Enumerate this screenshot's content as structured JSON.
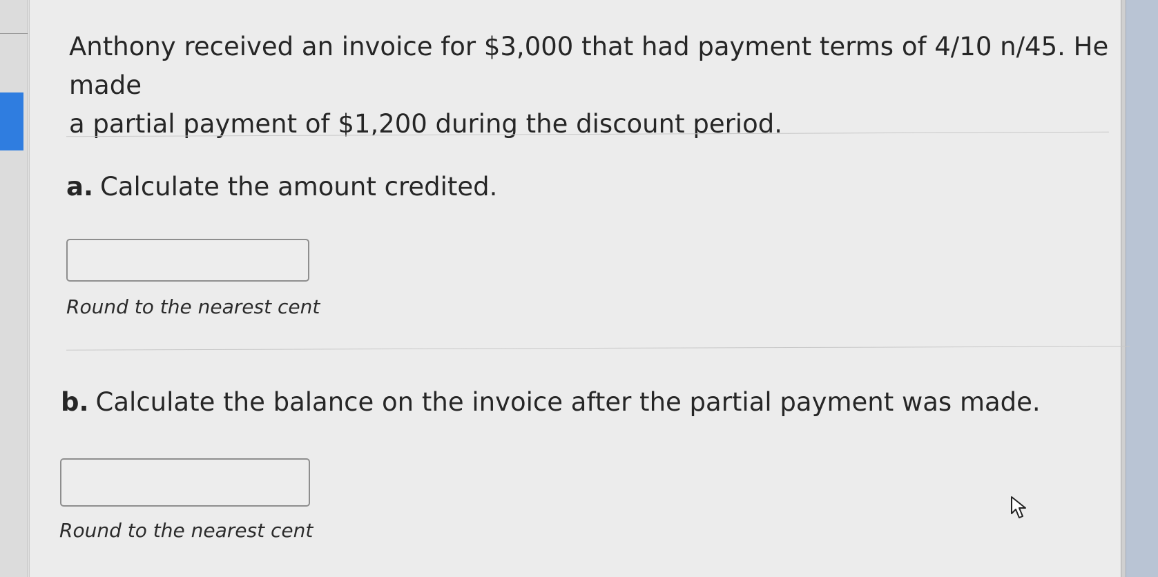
{
  "problem": {
    "line1": "Anthony received an invoice for $3,000 that had payment terms of 4/10 n/45. He made",
    "line2": "a partial payment of $1,200 during the discount period."
  },
  "question_a": {
    "letter": "a.",
    "text": "Calculate the amount credited.",
    "answer_value": "",
    "hint": "Round to the nearest cent"
  },
  "question_b": {
    "letter": "b.",
    "text": "Calculate the balance on the invoice after the partial payment was made.",
    "answer_value": "",
    "hint": "Round to the nearest cent"
  },
  "colors": {
    "nav_marker": "#2f7de0",
    "background": "#ececec",
    "text": "#262626"
  },
  "icons": {
    "cursor": "pointer-cursor-icon"
  }
}
